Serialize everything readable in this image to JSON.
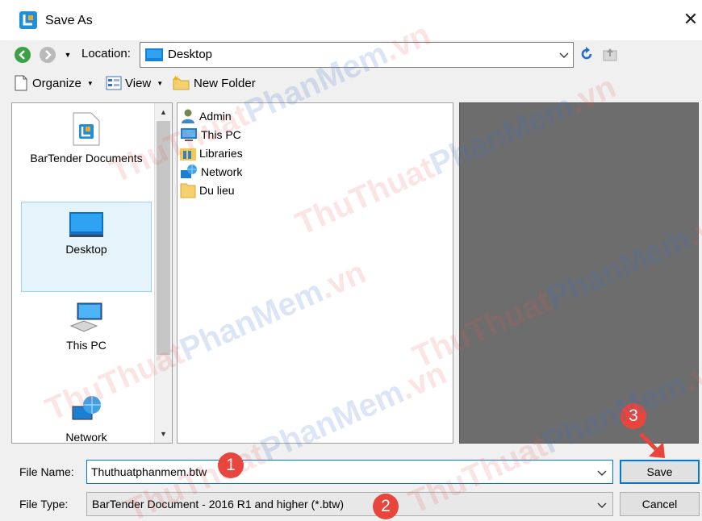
{
  "window": {
    "title": "Save As"
  },
  "nav": {
    "location_label": "Location:",
    "location_value": "Desktop"
  },
  "toolbar": {
    "organize": "Organize",
    "view": "View",
    "new_folder": "New Folder"
  },
  "places": [
    {
      "label": "BarTender Documents",
      "icon": "bartender-documents-icon"
    },
    {
      "label": "Desktop",
      "icon": "desktop-icon",
      "selected": true
    },
    {
      "label": "This PC",
      "icon": "this-pc-icon"
    },
    {
      "label": "Network",
      "icon": "network-icon"
    }
  ],
  "files": [
    {
      "name": "Admin",
      "icon": "user-icon"
    },
    {
      "name": "This PC",
      "icon": "computer-icon"
    },
    {
      "name": "Libraries",
      "icon": "libraries-icon"
    },
    {
      "name": "Network",
      "icon": "network-icon"
    },
    {
      "name": "Du lieu",
      "icon": "folder-icon"
    }
  ],
  "form": {
    "file_name_label": "File Name:",
    "file_name_value": "Thuthuatphanmem.btw",
    "file_type_label": "File Type:",
    "file_type_value": "BarTender Document - 2016 R1 and higher (*.btw)"
  },
  "buttons": {
    "save": "Save",
    "cancel": "Cancel"
  },
  "annotations": {
    "step1": "1",
    "step2": "2",
    "step3": "3"
  },
  "watermark": {
    "part1": "ThuThuat",
    "part2": "PhanMem",
    "part3": ".vn"
  },
  "colors": {
    "accent": "#0078d7",
    "badge": "#e8453c",
    "preview": "#6d6d6d"
  }
}
